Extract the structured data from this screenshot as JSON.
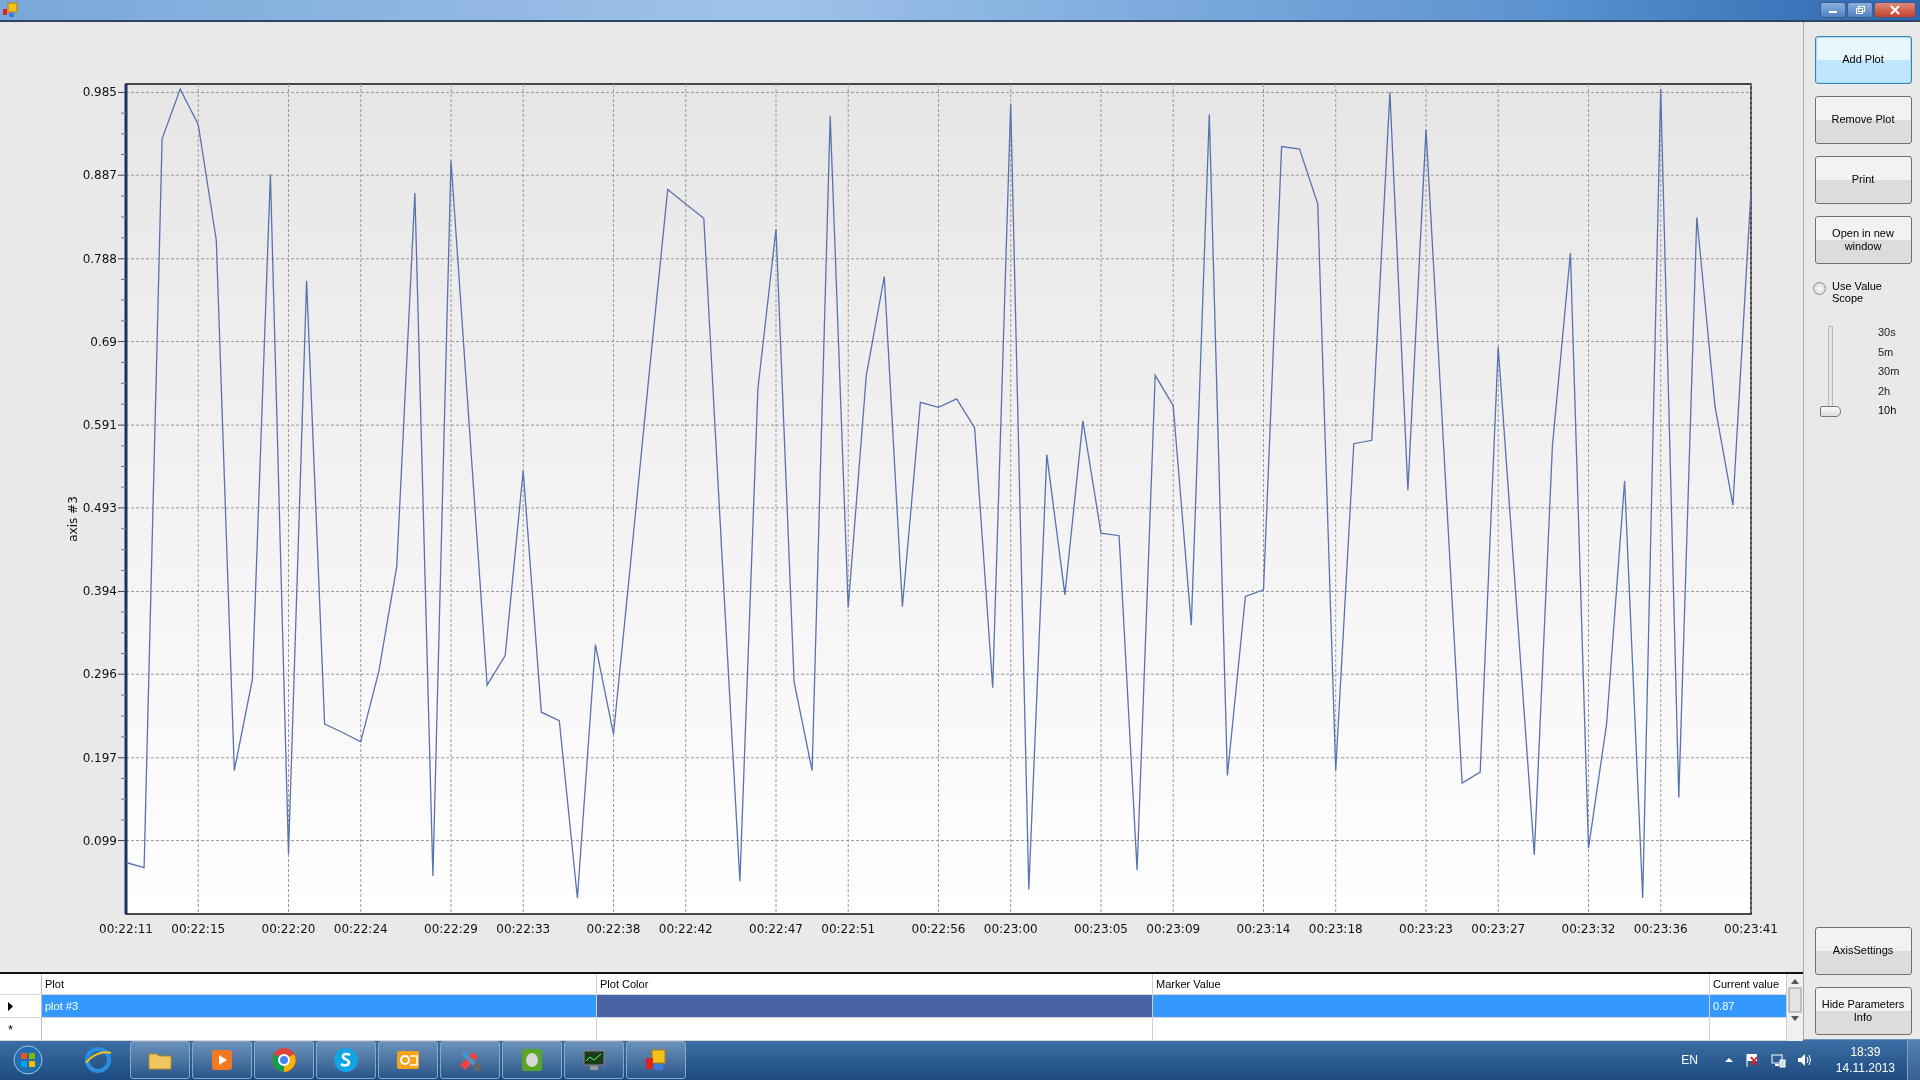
{
  "panel": {
    "buttons": [
      {
        "label": "Add Plot",
        "focused": true
      },
      {
        "label": "Remove Plot",
        "focused": false
      },
      {
        "label": "Print",
        "focused": false
      },
      {
        "label": "Open in new window",
        "focused": false
      }
    ],
    "radio": {
      "label": "Use Value Scope",
      "checked": false
    },
    "scope": [
      {
        "label": "30s",
        "selected": false
      },
      {
        "label": "5m",
        "selected": false
      },
      {
        "label": "30m",
        "selected": false
      },
      {
        "label": "2h",
        "selected": false
      },
      {
        "label": "10h",
        "selected": true
      }
    ],
    "bottom_buttons": [
      "AxisSettings",
      "Hide Parameters Info"
    ]
  },
  "chart": {
    "chart_data": {
      "type": "line",
      "ylabel": "axis #3",
      "grid": true,
      "ylim": [
        0.012,
        0.995
      ],
      "yticks": [
        0.099,
        0.197,
        0.296,
        0.394,
        0.493,
        0.591,
        0.69,
        0.788,
        0.887,
        0.985
      ],
      "categories": [
        "00:22:11",
        null,
        null,
        null,
        "00:22:15",
        null,
        null,
        null,
        null,
        "00:22:20",
        null,
        null,
        null,
        "00:22:24",
        null,
        null,
        null,
        null,
        "00:22:29",
        null,
        null,
        null,
        "00:22:33",
        null,
        null,
        null,
        null,
        "00:22:38",
        null,
        null,
        null,
        "00:22:42",
        null,
        null,
        null,
        null,
        "00:22:47",
        null,
        null,
        null,
        "00:22:51",
        null,
        null,
        null,
        null,
        "00:22:56",
        null,
        null,
        null,
        "00:23:00",
        null,
        null,
        null,
        null,
        "00:23:05",
        null,
        null,
        null,
        "00:23:09",
        null,
        null,
        null,
        null,
        "00:23:14",
        null,
        null,
        null,
        "00:23:18",
        null,
        null,
        null,
        null,
        "00:23:23",
        null,
        null,
        null,
        "00:23:27",
        null,
        null,
        null,
        null,
        "00:23:32",
        null,
        null,
        null,
        "00:23:36",
        null,
        null,
        null,
        null,
        "00:23:41"
      ],
      "series": [
        {
          "color": "#5a72b0",
          "values": [
            0.073,
            0.067,
            0.93,
            0.989,
            0.947,
            0.81,
            0.182,
            0.29,
            0.888,
            0.083,
            0.762,
            0.237,
            0.227,
            0.216,
            0.299,
            0.424,
            0.866,
            0.057,
            0.904,
            0.593,
            0.283,
            0.318,
            0.537,
            0.251,
            0.241,
            0.031,
            0.331,
            0.225,
            0.44,
            0.657,
            0.87,
            0.853,
            0.836,
            0.44,
            0.051,
            0.634,
            0.823,
            0.287,
            0.182,
            0.957,
            0.375,
            0.65,
            0.767,
            0.376,
            0.618,
            0.612,
            0.622,
            0.588,
            0.28,
            0.972,
            0.041,
            0.556,
            0.39,
            0.596,
            0.463,
            0.46,
            0.064,
            0.65,
            0.614,
            0.354,
            0.959,
            0.176,
            0.388,
            0.396,
            0.921,
            0.918,
            0.853,
            0.182,
            0.569,
            0.573,
            0.985,
            0.514,
            0.941,
            0.556,
            0.167,
            0.18,
            0.683,
            0.382,
            0.082,
            0.566,
            0.795,
            0.09,
            0.237,
            0.525,
            0.031,
            0.989,
            0.15,
            0.837,
            0.614,
            0.496,
            0.868
          ]
        }
      ]
    }
  },
  "grid": {
    "columns": [
      "Plot",
      "Plot Color",
      "Marker Value",
      "Current value"
    ],
    "rows": [
      {
        "plot": "plot #3",
        "color": "#4864a6",
        "current": "0.87",
        "selected": true
      }
    ],
    "new_row": "*"
  },
  "taskbar": {
    "items": [
      {
        "kind": "globe",
        "running": false
      },
      {
        "kind": "folder",
        "running": true
      },
      {
        "kind": "play",
        "running": true
      },
      {
        "kind": "ring",
        "running": true
      },
      {
        "kind": "chat",
        "running": true
      },
      {
        "kind": "mail",
        "running": true
      },
      {
        "kind": "tools",
        "running": true
      },
      {
        "kind": "note",
        "running": true
      },
      {
        "kind": "monitor",
        "running": true
      },
      {
        "kind": "app",
        "running": true
      }
    ],
    "language": "EN",
    "time": "18:39",
    "date": "14.11.2013"
  }
}
